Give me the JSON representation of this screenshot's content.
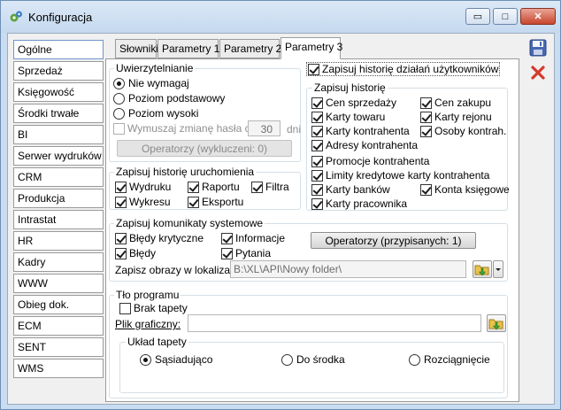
{
  "window": {
    "title": "Konfiguracja",
    "controls": {
      "minimize": "▭",
      "maximize": "□",
      "close": "✕"
    }
  },
  "sidebar": {
    "items": [
      "Ogólne",
      "Sprzedaż",
      "Księgowość",
      "Środki trwałe",
      "BI",
      "Serwer wydruków",
      "CRM",
      "Produkcja",
      "Intrastat",
      "HR",
      "Kadry",
      "WWW",
      "Obieg dok.",
      "ECM",
      "SENT",
      "WMS"
    ],
    "active": 0
  },
  "tabs": {
    "items": [
      "Słowniki",
      "Parametry 1",
      "Parametry 2",
      "Parametry 3"
    ],
    "active": 3
  },
  "auth": {
    "title": "Uwierzytelnianie",
    "options": [
      "Nie wymagaj",
      "Poziom podstawowy",
      "Poziom wysoki"
    ],
    "selected": 0,
    "force_change_label": "Wymuszaj zmianę hasła co",
    "force_change_value": "30",
    "days_label": "dni",
    "operators_button": "Operatorzy (wykluczeni: 0)"
  },
  "log_history": {
    "label": "Zapisuj historię działań użytkowników",
    "checked": true
  },
  "history": {
    "title": "Zapisuj historię",
    "items": {
      "cen_sprzedazy": "Cen sprzedaży",
      "cen_zakupu": "Cen zakupu",
      "karty_towaru": "Karty towaru",
      "karty_rejonu": "Karty rejonu",
      "karty_kontrahenta": "Karty kontrahenta",
      "osoby_kontrah": "Osoby kontrah.",
      "adresy_kontrahenta": "Adresy kontrahenta",
      "promocje_kontrahenta": "Promocje kontrahenta",
      "limity": "Limity kredytowe karty kontrahenta",
      "karty_bankow": "Karty banków",
      "konta_ksiegowe": "Konta księgowe",
      "karty_pracownika": "Karty pracownika"
    }
  },
  "launch_history": {
    "title": "Zapisuj historię uruchomienia",
    "items": {
      "wydruku": "Wydruku",
      "raportu": "Raportu",
      "filtra": "Filtra",
      "wykresu": "Wykresu",
      "eksportu": "Eksportu"
    }
  },
  "system_messages": {
    "title": "Zapisuj komunikaty systemowe",
    "items": {
      "bledy_krytyczne": "Błędy krytyczne",
      "informacje": "Informacje",
      "bledy": "Błędy",
      "pytania": "Pytania"
    },
    "operators_button": "Operatorzy (przypisanych: 1)",
    "save_images_label": "Zapisz obrazy w lokalizacji",
    "save_images_path": "B:\\XL\\API\\Nowy folder\\"
  },
  "background": {
    "title": "Tło programu",
    "no_wallpaper_label": "Brak tapety",
    "graphic_file_label": "Plik graficzny:",
    "graphic_file_value": "",
    "layout_title": "Układ tapety",
    "layout_options": [
      "Sąsiadująco",
      "Do środka",
      "Rozciągnięcie"
    ],
    "layout_selected": 0
  },
  "toolbar": {
    "save_tooltip": "",
    "cancel_tooltip": ""
  },
  "colors": {
    "save": "#3f5fa8",
    "cancel": "#d33a2a",
    "accent": "#6f95c9"
  }
}
